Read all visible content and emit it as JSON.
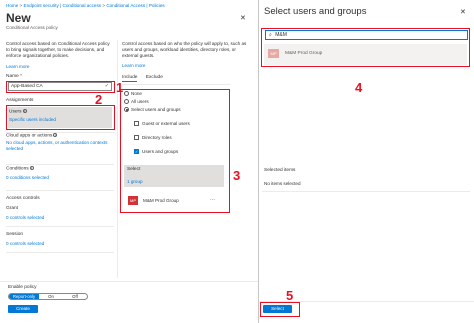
{
  "breadcrumb": {
    "items": [
      "Home",
      "Endpoint security | Conditional access",
      "Conditional Access | Policies"
    ],
    "separator": ">"
  },
  "page": {
    "title": "New",
    "subtitle": "Conditional Access policy",
    "close_glyph": "✕"
  },
  "left_panel": {
    "description": "Control access based on Conditional Access policy to bring signals together, to make decisions, and enforce organizational policies.",
    "learn_more": "Learn more",
    "name_label": "Name",
    "name_required": "*",
    "name_value": "App-Based CA",
    "assignments_heading": "Assignments",
    "users_label": "Users",
    "users_value": "Specific users included",
    "cloud_label": "Cloud apps or actions",
    "cloud_value": "No cloud apps, actions, or authentication contexts selected",
    "conditions_label": "Conditions",
    "conditions_value": "0 conditions selected",
    "access_controls_heading": "Access controls",
    "grant_label": "Grant",
    "grant_value": "0 controls selected",
    "session_label": "Session",
    "session_value": "0 controls selected",
    "enable_label": "Enable policy",
    "enable_options": [
      "Report-only",
      "On",
      "Off"
    ],
    "enable_selected": "Report-only",
    "create_button": "Create"
  },
  "middle_panel": {
    "description": "Control access based on who the policy will apply to, such as users and groups, workload identities, directory roles, or external guests.",
    "learn_more": "Learn more",
    "tabs": [
      "Include",
      "Exclude"
    ],
    "active_tab": "Include",
    "radio_options": [
      "None",
      "All users",
      "Select users and groups"
    ],
    "radio_selected": "Select users and groups",
    "checkbox_options": [
      {
        "label": "Guest or external users",
        "checked": false
      },
      {
        "label": "Directory roles",
        "checked": false
      },
      {
        "label": "Users and groups",
        "checked": true
      }
    ],
    "select_label": "Select",
    "select_value": "1 group",
    "group_initials": "MP",
    "group_name": "M&M Prod Group",
    "more_glyph": "···"
  },
  "right_panel": {
    "title": "Select users and groups",
    "search_value": "M&M",
    "result_initials": "MP",
    "result_name": "M&M Prod Group",
    "selected_heading": "Selected items",
    "selected_empty": "No items selected",
    "select_button": "Select"
  },
  "annotations": {
    "n1": "1",
    "n2": "2",
    "n3": "3",
    "n4": "4",
    "n5": "5"
  },
  "colors": {
    "accent": "#0078d4",
    "annotation": "#e81123",
    "group_tile": "#d13438"
  }
}
